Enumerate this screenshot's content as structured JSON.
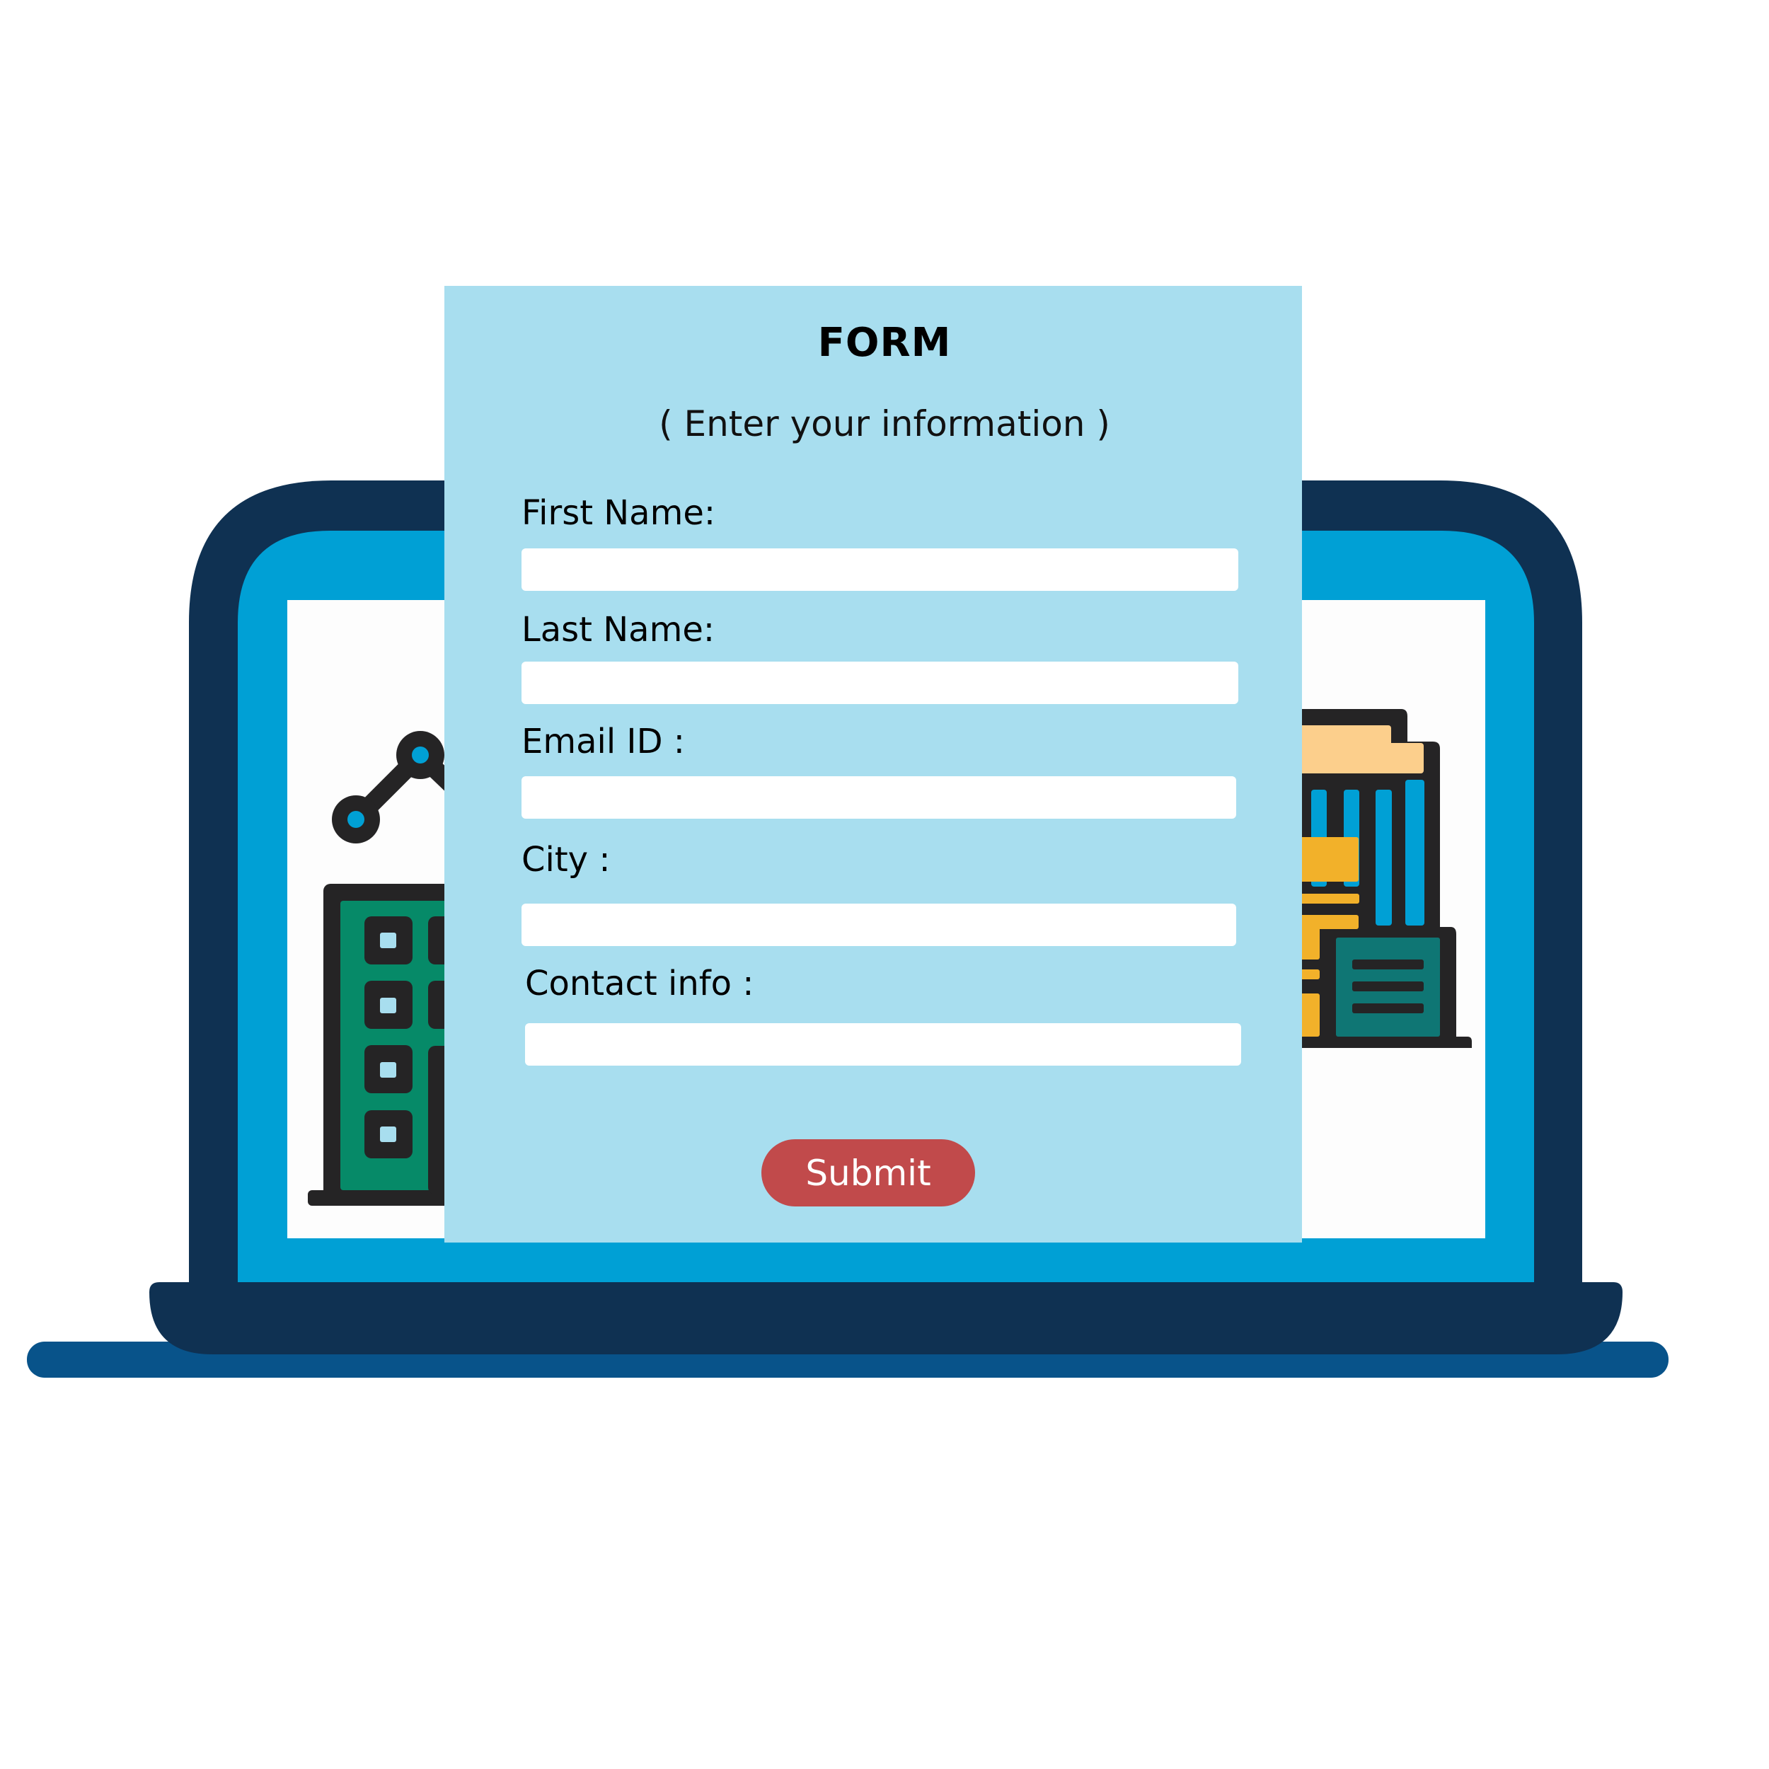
{
  "form": {
    "title": "FORM",
    "subtitle": "( Enter your information )",
    "fields": [
      {
        "label": "First Name:",
        "value": "",
        "placeholder": ""
      },
      {
        "label": "Last Name:",
        "value": "",
        "placeholder": ""
      },
      {
        "label": "Email ID :",
        "value": "",
        "placeholder": ""
      },
      {
        "label": "City :",
        "value": "",
        "placeholder": ""
      },
      {
        "label": "Contact info :",
        "value": "",
        "placeholder": ""
      }
    ],
    "submit_label": "Submit"
  },
  "illustration": {
    "device": "laptop-icon",
    "left_graphic": "building-icon",
    "right_graphic": "skyscraper-icon",
    "network_graphic": "network-nodes-icon"
  },
  "colors": {
    "laptop_frame": "#0F3152",
    "laptop_bezel": "#00A0D5",
    "laptop_base": "#08538A",
    "screen": "#FDFDFD",
    "form_panel": "#A8DEEF",
    "submit_button": "#C14A4B",
    "outline": "#252425",
    "green_building": "#068A68",
    "teal_building": "#0F7674",
    "yellow": "#F2B12A",
    "peach": "#FCCF8C",
    "window_blue": "#00A0D5",
    "window_light": "#A8DEEF"
  }
}
